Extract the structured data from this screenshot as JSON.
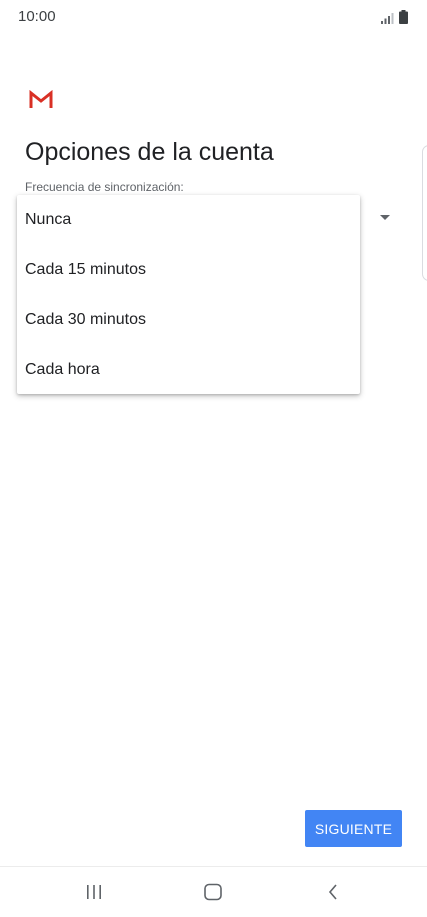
{
  "status_bar": {
    "time": "10:00",
    "icons": [
      "signal-icon",
      "battery-icon"
    ]
  },
  "header": {
    "logo": "gmail-logo-icon",
    "title": "Opciones de la cuenta"
  },
  "sync_field": {
    "label": "Frecuencia de sincronización:",
    "options": [
      "Nunca",
      "Cada 15 minutos",
      "Cada 30 minutos",
      "Cada hora"
    ]
  },
  "footer": {
    "next_label": "SIGUIENTE"
  },
  "nav_bar": {
    "icons": [
      "recent-apps-icon",
      "home-icon",
      "back-icon"
    ]
  },
  "colors": {
    "accent": "#4285f4",
    "gmail_red": "#d93025"
  }
}
